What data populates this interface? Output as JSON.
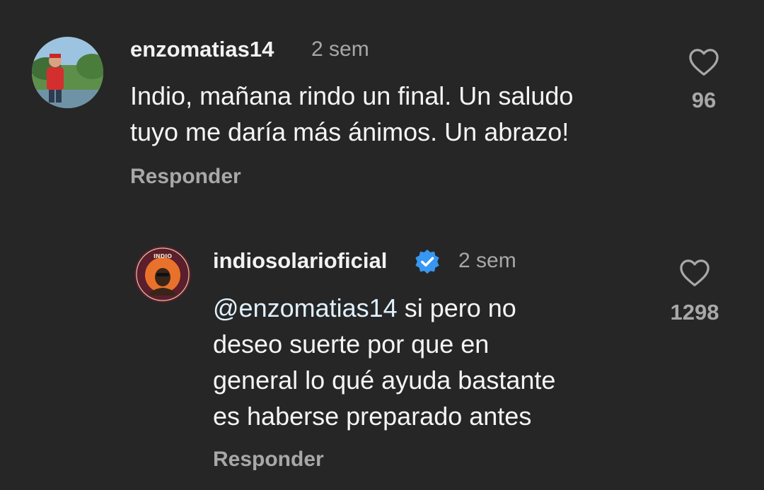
{
  "comment": {
    "username": "enzomatias14",
    "time": "2 sem",
    "text_lines": [
      "Indio, mañana rindo un final. Un saludo",
      "tuyo me daría más ánimos. Un abrazo!"
    ],
    "likes": "96",
    "reply_label": "Responder",
    "avatar_icon": "profile-photo-person-park"
  },
  "reply": {
    "username": "indiosolarioficial",
    "verified": true,
    "verified_color": "#3897f0",
    "time": "2 sem",
    "mention": "@enzomatias14",
    "text_lines": [
      " si pero no",
      "deseo suerte por que en",
      "general lo qué ayuda bastante",
      "es haberse preparado antes"
    ],
    "likes": "1298",
    "reply_label": "Responder",
    "avatar_badge_top": "INDIO",
    "avatar_icon": "artist-logo-badge"
  },
  "colors": {
    "background": "#262626",
    "secondary_text": "#a8a8a8"
  }
}
